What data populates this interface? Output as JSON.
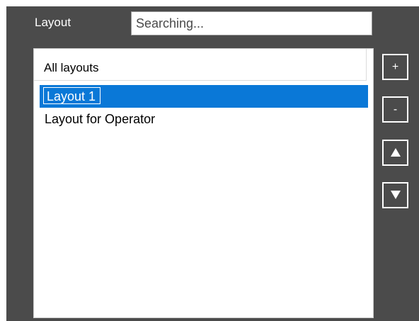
{
  "header": {
    "label": "Layout",
    "search": {
      "value": "",
      "placeholder": "Searching..."
    }
  },
  "list": {
    "header": "All layouts",
    "items": [
      {
        "label": "Layout 1",
        "selected": true,
        "editing": true
      },
      {
        "label": "Layout for Operator",
        "selected": false,
        "editing": false
      }
    ]
  },
  "buttons": {
    "add_label": "+",
    "remove_label": "-",
    "move_up_icon": "triangle-up-icon",
    "move_down_icon": "triangle-down-icon"
  },
  "colors": {
    "panel_background": "#4b4b4b",
    "selection": "#0a78d7",
    "list_background": "#ffffff",
    "button_border": "#ffffff"
  }
}
